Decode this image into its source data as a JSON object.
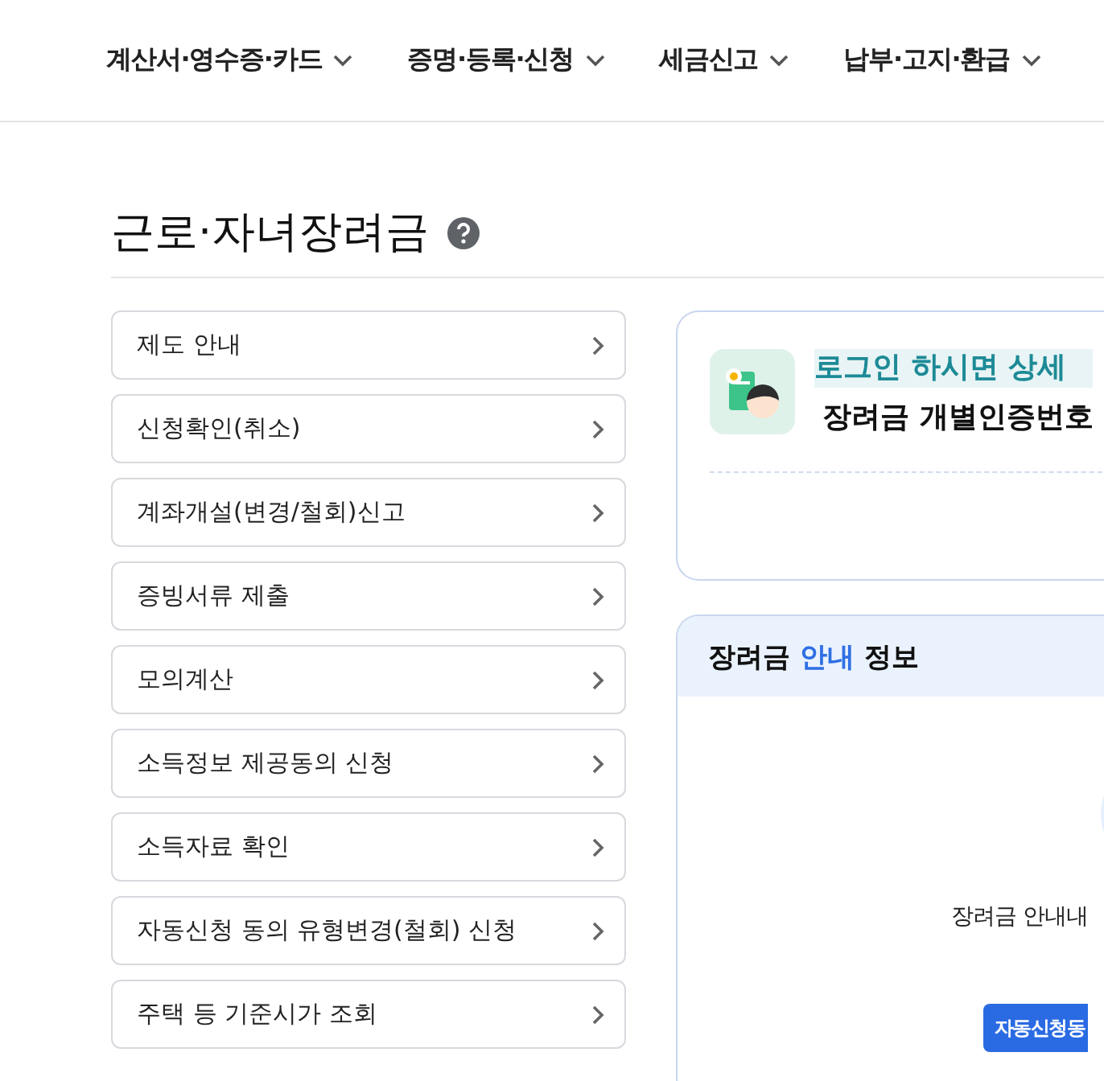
{
  "nav": [
    {
      "label": "계산서·영수증·카드"
    },
    {
      "label": "증명·등록·신청"
    },
    {
      "label": "세금신고"
    },
    {
      "label": "납부·고지·환급"
    }
  ],
  "page_title": "근로·자녀장려금",
  "menu": [
    {
      "label": "제도 안내"
    },
    {
      "label": "신청확인(취소)"
    },
    {
      "label": "계좌개설(변경/철회)신고"
    },
    {
      "label": "증빙서류 제출"
    },
    {
      "label": "모의계산"
    },
    {
      "label": "소득정보 제공동의 신청"
    },
    {
      "label": "소득자료 확인"
    },
    {
      "label": "자동신청 동의 유형변경(철회) 신청"
    },
    {
      "label": "주택 등 기준시가 조회"
    }
  ],
  "login_card": {
    "headline": "로그인 하시면 상세",
    "subline": "장려금 개별인증번호"
  },
  "info_card": {
    "title_before": "장려금 ",
    "title_highlight": "안내",
    "title_after": " 정보",
    "message": "장려금 안내내",
    "button": "자동신청동"
  }
}
